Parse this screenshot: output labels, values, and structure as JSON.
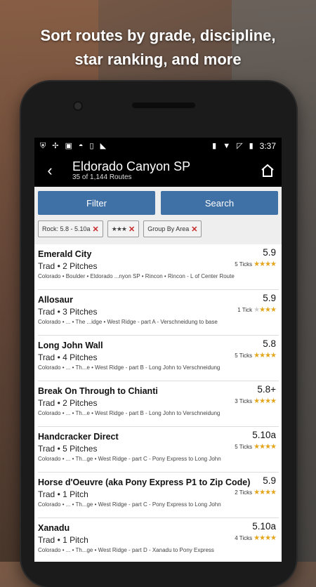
{
  "headline": {
    "line1": "Sort routes by grade, discipline,",
    "line2": "star ranking, and more"
  },
  "status_bar": {
    "time": "3:37",
    "left_icons": [
      "shield-icon",
      "pinwheel-icon",
      "image-icon",
      "android-icon",
      "tablet-icon",
      "bell-icon"
    ],
    "right_icons": [
      "vibrate-icon",
      "wifi-icon",
      "no-signal-icon",
      "battery-icon"
    ]
  },
  "app_bar": {
    "title": "Eldorado Canyon SP",
    "subtitle": "35 of 1,144 Routes"
  },
  "buttons": {
    "filter": "Filter",
    "search": "Search"
  },
  "chips": [
    {
      "label": "Rock: 5.8 - 5.10a"
    },
    {
      "stars": "★★★"
    },
    {
      "label": "Group By Area"
    }
  ],
  "routes": [
    {
      "name": "Emerald City",
      "meta": "Trad • 2 Pitches",
      "grade": "5.9",
      "ticks": "5 Ticks",
      "stars": "★★★★",
      "dim": "",
      "path": "Colorado • Boulder • Eldorado ...nyon SP • Rincon • Rincon - L of Center Route"
    },
    {
      "name": "Allosaur",
      "meta": "Trad • 3 Pitches",
      "grade": "5.9",
      "ticks": "1 Tick",
      "stars": "★★★",
      "dim": "★",
      "path": "Colorado • ... • The ...idge • West Ridge - part A - Verschneidung to base"
    },
    {
      "name": "Long John Wall",
      "meta": "Trad • 4 Pitches",
      "grade": "5.8",
      "ticks": "5 Ticks",
      "stars": "★★★★",
      "dim": "",
      "path": "Colorado • ... • Th...e • West Ridge - part B - Long John to Verschneidung"
    },
    {
      "name": "Break On Through to Chianti",
      "meta": "Trad • 2 Pitches",
      "grade": "5.8+",
      "ticks": "3 Ticks",
      "stars": "★★★★",
      "dim": "",
      "path": "Colorado • ... • Th...e • West Ridge - part B - Long John to Verschneidung"
    },
    {
      "name": "Handcracker Direct",
      "meta": "Trad • 5 Pitches",
      "grade": "5.10a",
      "ticks": "5 Ticks",
      "stars": "★★★★",
      "dim": "",
      "path": "Colorado • ... • Th...ge • West Ridge - part C - Pony Express to Long John"
    },
    {
      "name": "Horse d'Oeuvre (aka Pony Express P1 to Zip Code)",
      "meta": "Trad • 1 Pitch",
      "grade": "5.9",
      "ticks": "2 Ticks",
      "stars": "★★★★",
      "dim": "",
      "path": "Colorado • ... • Th...ge • West Ridge - part C - Pony Express to Long John"
    },
    {
      "name": "Xanadu",
      "meta": "Trad • 1 Pitch",
      "grade": "5.10a",
      "ticks": "4 Ticks",
      "stars": "★★★★",
      "dim": "",
      "path": "Colorado • ... • Th...ge • West Ridge - part D - Xanadu to Pony Express"
    }
  ],
  "colors": {
    "button": "#3f70a6",
    "star": "#e3a51a",
    "chip_x": "#c62828"
  }
}
